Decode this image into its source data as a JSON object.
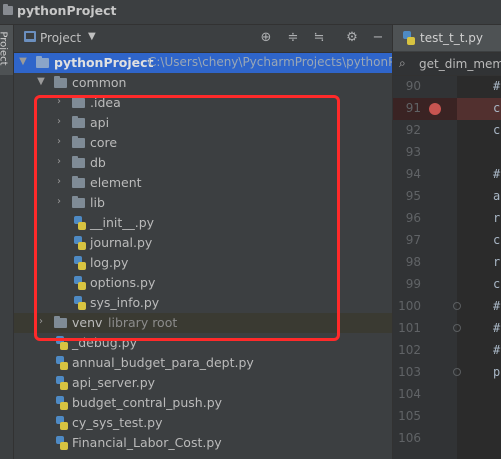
{
  "titlebar": {
    "title": "pythonProject"
  },
  "sidestrip": {
    "tab_label": "Project"
  },
  "project_panel": {
    "header_label": "Project",
    "dropdown_glyph": "▼",
    "icons": [
      "crosshair-icon",
      "collapse-all-icon",
      "expand-all-icon",
      "gear-icon",
      "minimize-icon"
    ]
  },
  "tree": {
    "root": {
      "name": "pythonProject",
      "path": "C:\\Users\\cheny\\PycharmProjects\\pythonPr"
    },
    "common": {
      "name": "common"
    },
    "folders": [
      ".idea",
      "api",
      "core",
      "db",
      "element",
      "lib"
    ],
    "common_files": [
      "__init__.py",
      "journal.py",
      "log.py",
      "options.py",
      "sys_info.py"
    ],
    "venv": {
      "name": "venv",
      "note": "library root"
    },
    "root_files": [
      "_debug.py",
      "annual_budget_para_dept.py",
      "api_server.py",
      "budget_contral_push.py",
      "cy_sys_test.py",
      "Financial_Labor_Cost.py"
    ]
  },
  "editor": {
    "tab_label": "test_t_t.py",
    "breadcrumb": "get_dim_memb",
    "lines": [
      {
        "num": "90",
        "code": "#"
      },
      {
        "num": "91",
        "code": "c",
        "breakpoint": true
      },
      {
        "num": "92",
        "code": "c"
      },
      {
        "num": "93",
        "code": ""
      },
      {
        "num": "94",
        "code": "#"
      },
      {
        "num": "95",
        "code": "a"
      },
      {
        "num": "96",
        "code": "r"
      },
      {
        "num": "97",
        "code": "c"
      },
      {
        "num": "98",
        "code": "r"
      },
      {
        "num": "99",
        "code": "c"
      },
      {
        "num": "100",
        "code": "#"
      },
      {
        "num": "101",
        "code": "#"
      },
      {
        "num": "102",
        "code": "#"
      },
      {
        "num": "103",
        "code": "p"
      },
      {
        "num": "104",
        "code": ""
      },
      {
        "num": "105",
        "code": ""
      },
      {
        "num": "106",
        "code": ""
      }
    ]
  },
  "colors": {
    "highlight_box": "#ff2a2a",
    "selection": "#2f65ca",
    "breakpoint": "#c75450"
  }
}
